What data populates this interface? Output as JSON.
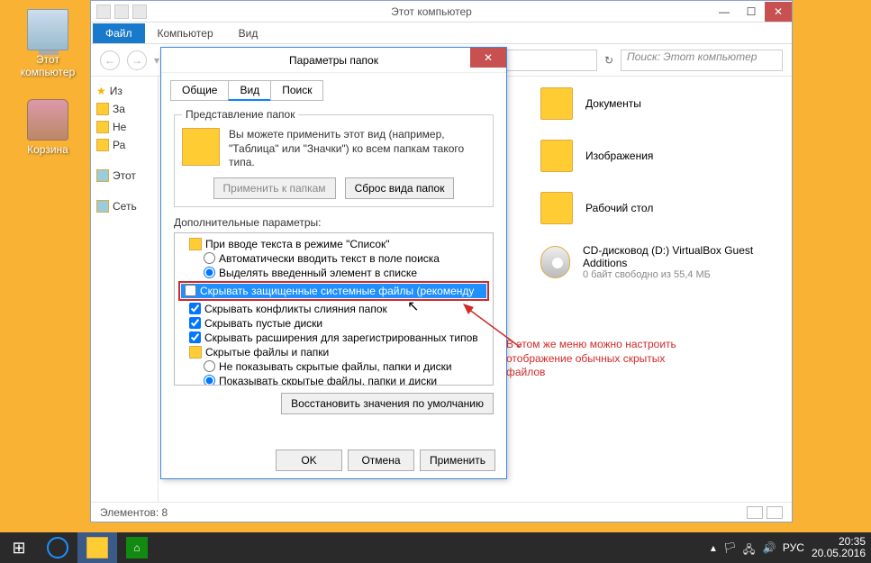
{
  "desktop": {
    "computer": "Этот компьютер",
    "bin": "Корзина"
  },
  "explorer": {
    "title": "Этот компьютер",
    "file": "Файл",
    "tabs": [
      "Компьютер",
      "Вид"
    ],
    "searchPlaceholder": "Поиск: Этот компьютер",
    "tree": {
      "fav": "Из",
      "downloads": "За",
      "recent": "Не",
      "desktop": "Ра",
      "thispc": "Этот",
      "network": "Сеть"
    },
    "items": {
      "docs": "Документы",
      "images": "Изображения",
      "desk": "Рабочий стол",
      "cd": "CD-дисковод (D:) VirtualBox Guest Additions",
      "cdSub": "0 байт свободно из 55,4 МБ"
    },
    "status": "Элементов: 8"
  },
  "dialog": {
    "title": "Параметры папок",
    "tabs": {
      "general": "Общие",
      "view": "Вид",
      "search": "Поиск"
    },
    "fv": {
      "legend": "Представление папок",
      "text": "Вы можете применить этот вид (например, \"Таблица\" или \"Значки\") ко всем папкам такого типа.",
      "apply": "Применить к папкам",
      "reset": "Сброс вида папок"
    },
    "advLabel": "Дополнительные параметры:",
    "adv": {
      "r0": "При вводе текста в режиме \"Список\"",
      "r1": "Автоматически вводить текст в поле поиска",
      "r2": "Выделять введенный элемент в списке",
      "r3": "Скрывать защищенные системные файлы (рекоменду",
      "r4": "Скрывать конфликты слияния папок",
      "r5": "Скрывать пустые диски",
      "r6": "Скрывать расширения для зарегистрированных типов",
      "r7": "Скрытые файлы и папки",
      "r8": "Не показывать скрытые файлы, папки и диски",
      "r9": "Показывать скрытые файлы, папки и диски"
    },
    "restore": "Восстановить значения по умолчанию",
    "ok": "OK",
    "cancel": "Отмена",
    "applyBtn": "Применить"
  },
  "callout": "В этом же меню можно настроить отображение обычных скрытых файлов",
  "tray": {
    "lang": "РУС",
    "time": "20:35",
    "date": "20.05.2016"
  }
}
